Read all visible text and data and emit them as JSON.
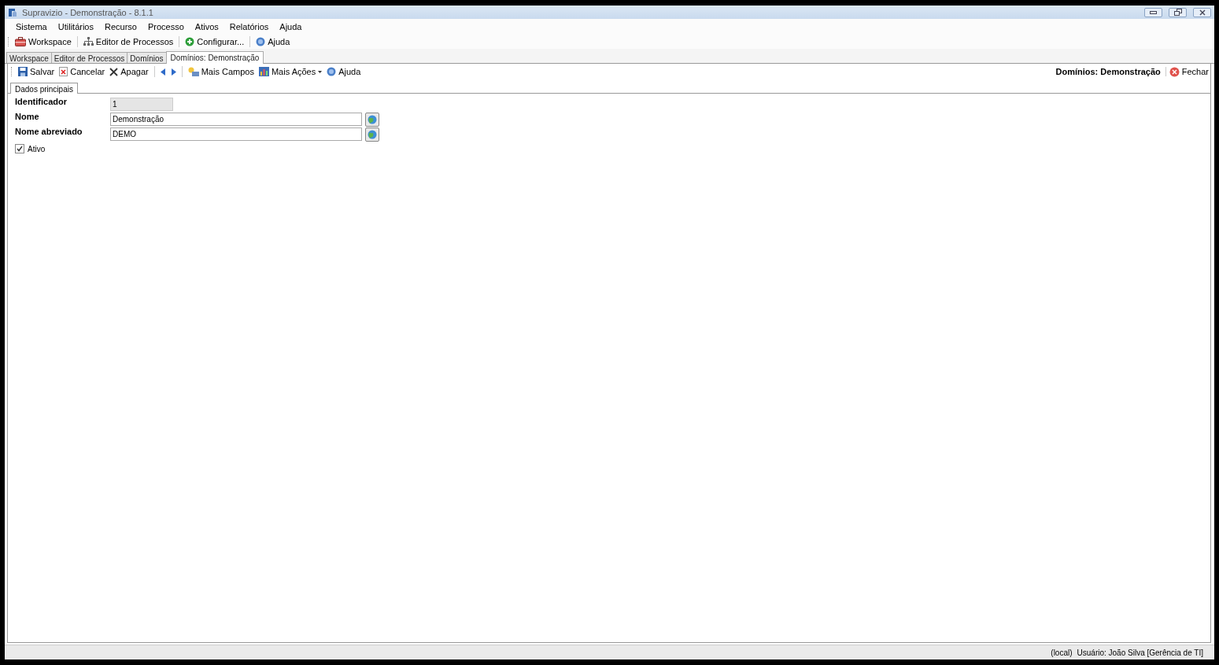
{
  "window": {
    "title": "Supravizio - Demonstração - 8.1.1"
  },
  "menu": [
    "Sistema",
    "Utilitários",
    "Recurso",
    "Processo",
    "Ativos",
    "Relatórios",
    "Ajuda"
  ],
  "toolbar": [
    {
      "kind": "button",
      "label": "Workspace"
    },
    {
      "kind": "separator"
    },
    {
      "kind": "button",
      "label": "Editor de Processos"
    },
    {
      "kind": "separator"
    },
    {
      "kind": "button",
      "label": "Configurar..."
    },
    {
      "kind": "separator"
    },
    {
      "kind": "button",
      "label": "Ajuda"
    }
  ],
  "tabs": [
    {
      "label": "Workspace",
      "selected": false
    },
    {
      "label": "Editor de Processos",
      "selected": false
    },
    {
      "label": "Domínios",
      "selected": false
    },
    {
      "label": "Domínios: Demonstração",
      "selected": true
    }
  ],
  "actions": [
    {
      "kind": "button",
      "label": "Salvar"
    },
    {
      "kind": "button",
      "label": "Cancelar"
    },
    {
      "kind": "button",
      "label": "Apagar"
    },
    {
      "kind": "separator"
    },
    {
      "kind": "button"
    },
    {
      "kind": "button"
    },
    {
      "kind": "separator"
    },
    {
      "kind": "button",
      "label": "Mais Campos"
    },
    {
      "kind": "button",
      "label": "Mais Ações"
    },
    {
      "kind": "button",
      "label": "Ajuda"
    }
  ],
  "document_title": "Domínios: Demonstração",
  "close_button": "Fechar",
  "subtabs": [
    {
      "label": "Dados principais",
      "selected": true
    }
  ],
  "fields": [
    {
      "label": "Identificador",
      "value": "1",
      "kind": "readonly"
    },
    {
      "label": "Nome",
      "value": "Demonstração",
      "kind": "translatable"
    },
    {
      "label": "Nome abreviado",
      "value": "DEMO",
      "kind": "translatable"
    }
  ],
  "checkbox": {
    "label": "Ativo",
    "checked": true
  },
  "status_bar": {
    "server": "(local)",
    "user": "Usuário: João Silva [Gerência de TI]"
  }
}
